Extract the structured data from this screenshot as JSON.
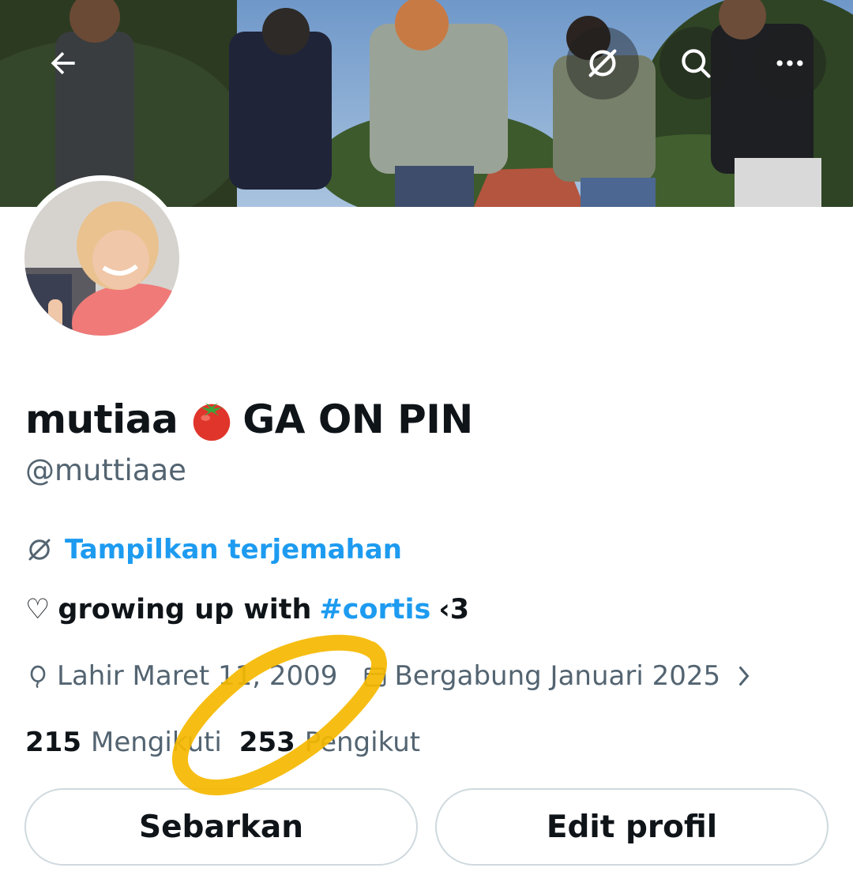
{
  "header": {
    "back_icon": "arrow-left-icon",
    "translate_icon": "translate-icon",
    "search_icon": "search-icon",
    "more_icon": "more-horizontal-icon"
  },
  "profile": {
    "display_name_part1": "mutiaa",
    "display_name_emoji": "tomato-emoji",
    "display_name_part2": "GA ON PIN",
    "handle": "@muttiaae",
    "translate_label": "Tampilkan terjemahan",
    "bio": {
      "heart": "♡",
      "text_before": "growing up with",
      "hashtag": "#cortis",
      "text_after": "‹3"
    },
    "birth": "Lahir Maret 11, 2009",
    "joined": "Bergabung Januari 2025",
    "following_count": "215",
    "following_label": "Mengikuti",
    "followers_count": "253",
    "followers_label": "Pengikut"
  },
  "actions": {
    "share_label": "Sebarkan",
    "edit_label": "Edit profil"
  },
  "colors": {
    "accent": "#1d9bf0",
    "secondary_text": "#536471",
    "primary_text": "#0f1419",
    "border": "#cfd9de",
    "scribble": "#f5b800"
  }
}
